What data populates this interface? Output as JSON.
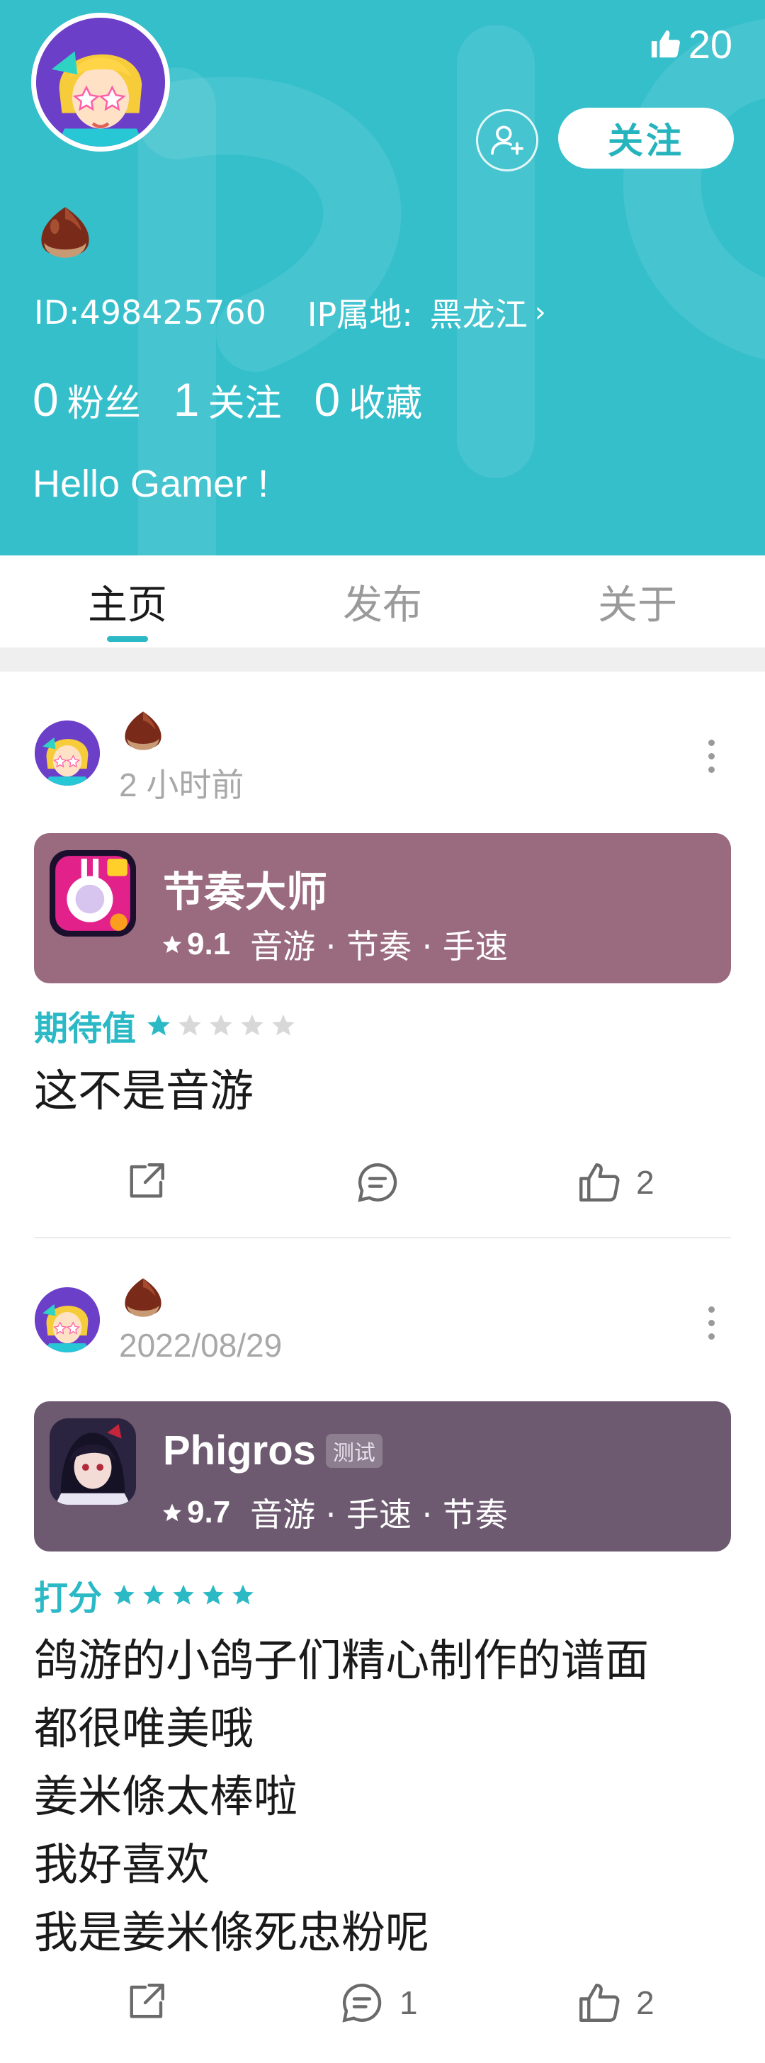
{
  "colors": {
    "header_bg": "#34bfcb",
    "accent": "#2bb9c5",
    "card1_bg": "#9a6a7e",
    "card2_bg": "#6d5a70"
  },
  "profile": {
    "likes": "20",
    "follow_label": "关注",
    "id_text": "ID:498425760",
    "ip_label": "IP属地:",
    "ip_value": "黑龙江",
    "stats": [
      {
        "num": "0",
        "label": "粉丝"
      },
      {
        "num": "1",
        "label": "关注"
      },
      {
        "num": "0",
        "label": "收藏"
      }
    ],
    "bio": "Hello Gamer !"
  },
  "tabs": [
    "主页",
    "发布",
    "关于"
  ],
  "posts": [
    {
      "time": "2 小时前",
      "game": {
        "name": "节奏大师",
        "score": "9.1",
        "tags": "音游 · 节奏 · 手速"
      },
      "rating_label": "期待值",
      "rating_stars": 1,
      "lines": [
        "这不是音游"
      ],
      "comments": "",
      "likes": "2"
    },
    {
      "time": "2022/08/29",
      "game": {
        "name": "Phigros",
        "badge": "测试",
        "score": "9.7",
        "tags": "音游 · 手速 · 节奏"
      },
      "rating_label": "打分",
      "rating_stars": 5,
      "lines": [
        "鸽游的小鸽子们精心制作的谱面",
        "都很唯美哦",
        "姜米條太棒啦",
        "我好喜欢",
        "我是姜米條死忠粉呢"
      ],
      "comments": "1",
      "likes": "2"
    }
  ]
}
